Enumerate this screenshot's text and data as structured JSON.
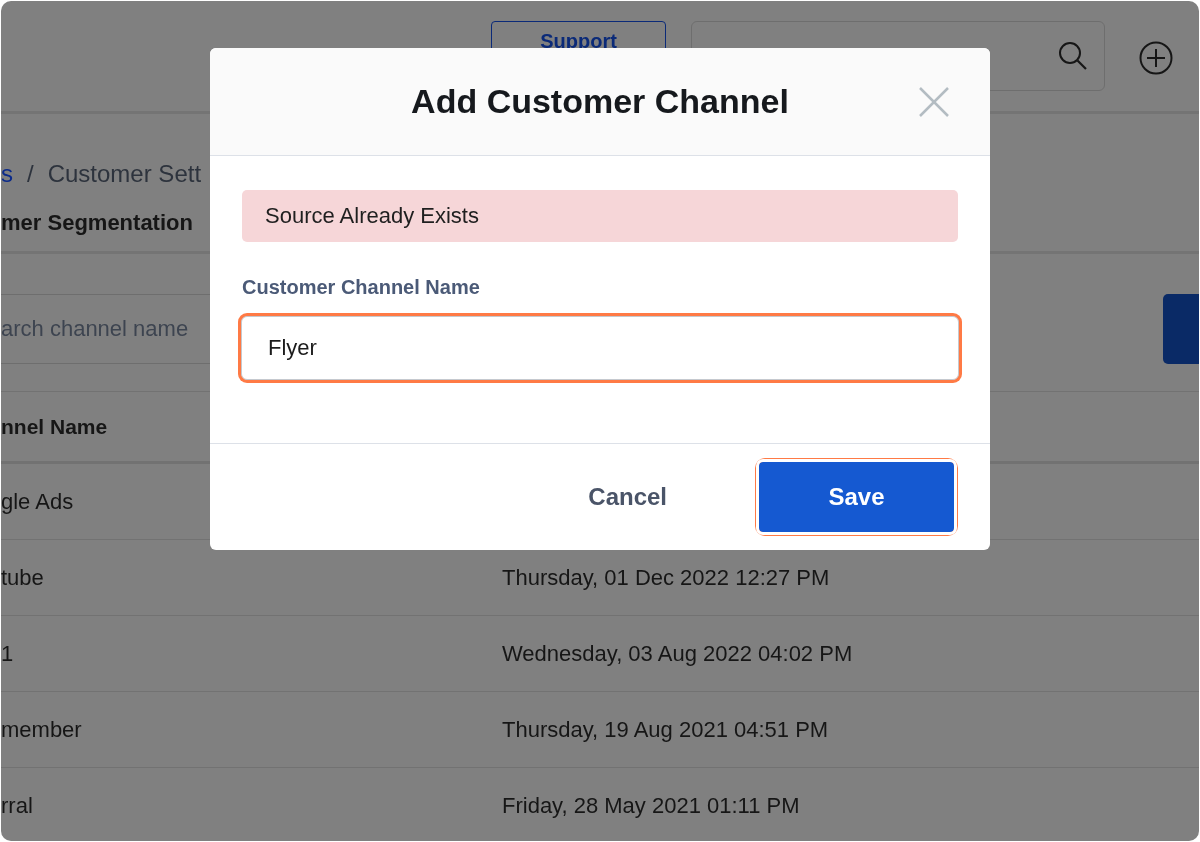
{
  "header": {
    "support_button": "Support"
  },
  "breadcrumb": {
    "items": [
      {
        "label": "s",
        "kind": "link"
      },
      {
        "label": "Customer Sett",
        "kind": "current"
      }
    ],
    "separator": "/"
  },
  "section_title": "mer Segmentation",
  "channel_search": {
    "placeholder": "arch channel name"
  },
  "table": {
    "columns": [
      "nnel Name"
    ],
    "rows": [
      {
        "name": "gle Ads"
      },
      {
        "name": "tube",
        "date": "Thursday, 01 Dec 2022 12:27 PM"
      },
      {
        "name": "1",
        "date": "Wednesday, 03 Aug 2022 04:02 PM"
      },
      {
        "name": "member",
        "date": "Thursday, 19 Aug 2021 04:51 PM"
      },
      {
        "name": "rral",
        "date": "Friday, 28 May 2021 01:11 PM"
      }
    ]
  },
  "modal": {
    "title": "Add Customer Channel",
    "alert": "Source Already Exists",
    "field_label": "Customer Channel Name",
    "field_value": "Flyer",
    "field_highlighted": true,
    "buttons": [
      {
        "label": "Cancel",
        "kind": "secondary",
        "highlighted": false
      },
      {
        "label": "Save",
        "kind": "primary",
        "highlighted": true
      }
    ]
  }
}
